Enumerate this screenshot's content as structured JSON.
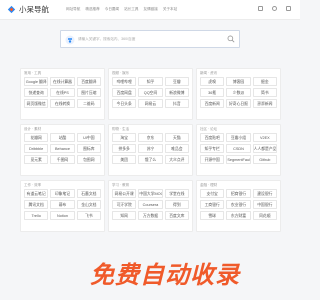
{
  "header": {
    "logo_text": "小呆导航",
    "nav": [
      "网址导航",
      "精选推荐",
      "今日要闻",
      "站长工具",
      "友情链接",
      "关于本站"
    ]
  },
  "search": {
    "placeholder": "请输入关键字，搜索站内、360/百度",
    "engine_icon": "search-engine-icon",
    "button_icon": "search-icon"
  },
  "sections": [
    {
      "title": "常用 · 工具",
      "links": [
        "Google 翻译",
        "在线计算器",
        "百度翻译",
        "快递查询",
        "在线PS",
        "图片压缩",
        "网页版微信",
        "在线转换",
        "二维码"
      ]
    },
    {
      "title": "视频 · 娱乐",
      "links": [
        "哔哩哔哩",
        "知乎",
        "豆瓣",
        "百度网盘",
        "QQ空间",
        "新浪微博",
        "今日头条",
        "网易云",
        "抖音"
      ]
    },
    {
      "title": "新闻 · 资讯",
      "links": [
        "虎嗅",
        "博客园",
        "掘金",
        "36氪",
        "少数派",
        "简书",
        "百度新闻",
        "好奇心日报",
        "澎湃新闻"
      ]
    },
    {
      "title": "设计 · 素材",
      "links": [
        "花瓣网",
        "站酷",
        "UI中国",
        "Dribbble",
        "Behance",
        "图标库",
        "觅元素",
        "千图网",
        "包图网"
      ]
    },
    {
      "title": "购物 · 生活",
      "links": [
        "淘宝",
        "京东",
        "天猫",
        "拼多多",
        "苏宁",
        "唯品会",
        "美团",
        "饿了么",
        "大众点评"
      ]
    },
    {
      "title": "社区 · 论坛",
      "links": [
        "百度贴吧",
        "豆瓣小组",
        "V2EX",
        "知乎专栏",
        "CSDN",
        "人人都是产品经理",
        "开源中国",
        "SegmentFault",
        "Github"
      ]
    },
    {
      "title": "工作 · 效率",
      "links": [
        "有道云笔记",
        "印象笔记",
        "石墨文档",
        "腾讯文档",
        "幕布",
        "金山文档",
        "Trello",
        "Notion",
        "飞书"
      ]
    },
    {
      "title": "学习 · 教育",
      "links": [
        "网易公开课",
        "中国大学MOOC",
        "学堂在线",
        "可汗学院",
        "Coursera",
        "得到",
        "知网",
        "万方数据",
        "百度文库"
      ]
    },
    {
      "title": "金融 · 理财",
      "links": [
        "支付宝",
        "招商银行",
        "建设银行",
        "工商银行",
        "农业银行",
        "中国银行",
        "雪球",
        "东方财富",
        "同花顺"
      ]
    }
  ],
  "watermark": "免费自动收录"
}
